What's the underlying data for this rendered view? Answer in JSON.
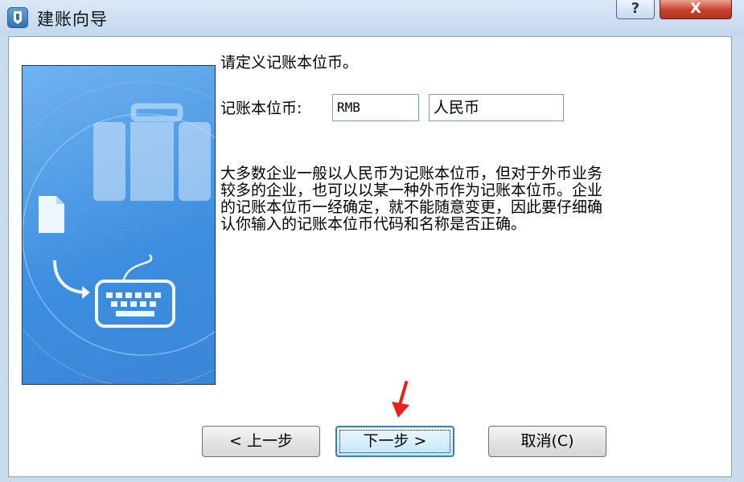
{
  "window": {
    "title": "建账向导",
    "help_label": "?",
    "close_label": "X"
  },
  "main": {
    "prompt": "请定义记账本位币。",
    "currency_label": "记账本位币:",
    "currency_code": "RMB",
    "currency_name": "人民币",
    "description": "大多数企业一般以人民币为记账本位币，但对于外币业务较多的企业，也可以以某一种外币作为记账本位币。企业的记账本位币一经确定，就不能随意变更，因此要仔细确认你输入的记账本位币代码和名称是否正确。"
  },
  "buttons": {
    "prev": "< 上一步",
    "next": "下一步 >",
    "cancel": "取消(C)"
  },
  "colors": {
    "annotation_arrow": "#e8211b",
    "illustration_blue": "#3d8ee0"
  },
  "icons": [
    "app-logo-icon",
    "help-icon",
    "close-icon",
    "briefcase-icon",
    "document-icon",
    "curved-arrow-icon",
    "keyboard-icon"
  ]
}
